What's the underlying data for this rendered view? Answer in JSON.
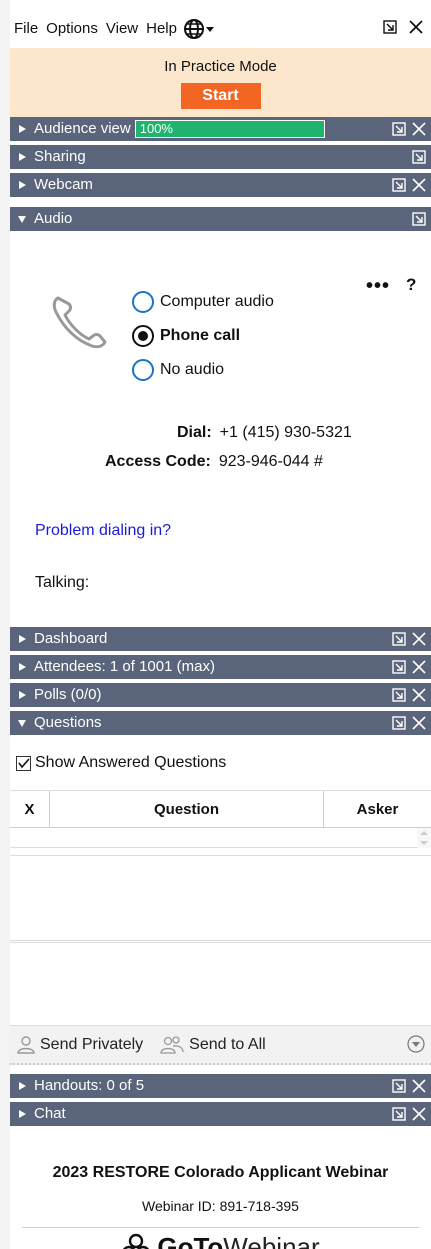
{
  "menu": {
    "items": [
      "File",
      "Options",
      "View",
      "Help"
    ],
    "globe_icon": "globe-icon"
  },
  "practice": {
    "title": "In Practice Mode",
    "start_label": "Start"
  },
  "sections": {
    "audience_view": {
      "label": "Audience view",
      "progress_percent": 100,
      "progress_text": "100%"
    },
    "sharing": {
      "label": "Sharing"
    },
    "webcam": {
      "label": "Webcam"
    },
    "audio": {
      "label": "Audio"
    },
    "dashboard": {
      "label": "Dashboard"
    },
    "attendees": {
      "label": "Attendees:  1 of 1001 (max)"
    },
    "polls": {
      "label": "Polls (0/0)"
    },
    "questions": {
      "label": "Questions"
    },
    "handouts": {
      "label": "Handouts: 0 of 5"
    },
    "chat": {
      "label": "Chat"
    }
  },
  "audio": {
    "more_label": "•••",
    "help_label": "?",
    "options": [
      {
        "label": "Computer audio",
        "selected": false
      },
      {
        "label": "Phone call",
        "selected": true
      },
      {
        "label": "No audio",
        "selected": false
      }
    ],
    "dial_label": "Dial:",
    "dial_value": "+1 (415) 930-5321",
    "access_label": "Access Code:",
    "access_value": "923-946-044 #",
    "problem_link": "Problem dialing in?",
    "talking_label": "Talking:"
  },
  "questions": {
    "show_answered_label": "Show Answered Questions",
    "columns": [
      "X",
      "Question",
      "Asker"
    ],
    "send_privately": "Send Privately",
    "send_to_all": "Send to All"
  },
  "footer": {
    "webinar_title": "2023 RESTORE Colorado Applicant Webinar",
    "webinar_id": "Webinar ID: 891-718-395",
    "brand_bold": "GoTo",
    "brand_light": "Webinar"
  },
  "colors": {
    "bar": "#5a647a",
    "practice_bg": "#fde7cc",
    "start": "#f26522",
    "progress": "#1fb36e",
    "link": "#1a1adc"
  }
}
